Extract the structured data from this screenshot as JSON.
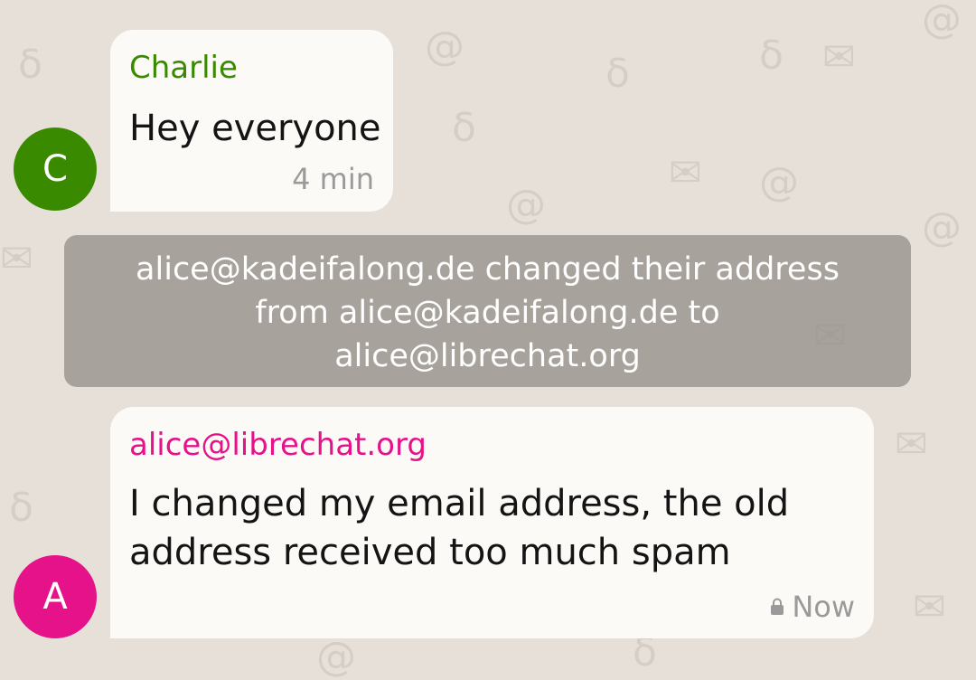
{
  "messages": [
    {
      "avatar_letter": "C",
      "sender": "Charlie",
      "text_lines": [
        "Hey everyone"
      ],
      "time": "4 min",
      "color": "#3a8a00"
    },
    {
      "avatar_letter": "A",
      "sender": "alice@librechat.org",
      "text_lines": [
        "I changed my email address, the old",
        "address received too much spam"
      ],
      "time": "Now",
      "color": "#e5128a",
      "icon": "lock-icon"
    }
  ],
  "system_message": {
    "lines": [
      "alice@kadeifalong.de changed their address",
      "from alice@kadeifalong.de to",
      "alice@librechat.org"
    ]
  },
  "background_icons": [
    "mail-icon",
    "at-icon",
    "delta-icon",
    "chat-bubble-icon",
    "forward-arrow-icon"
  ]
}
